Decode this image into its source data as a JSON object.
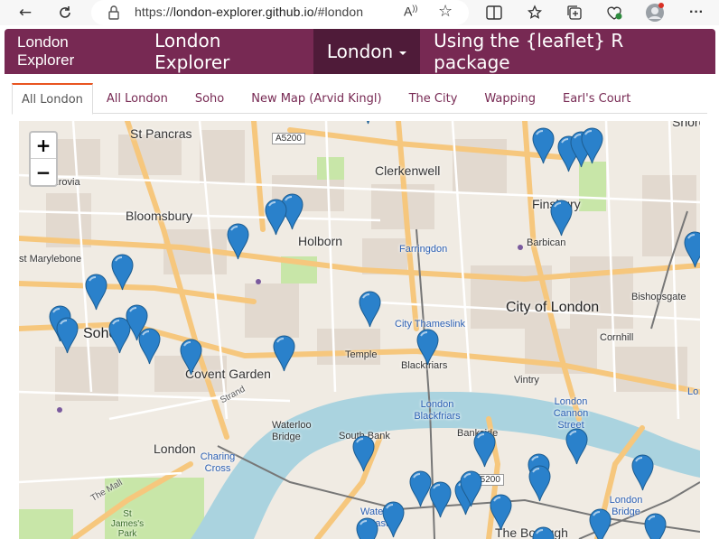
{
  "browser": {
    "url_prefix": "https://",
    "url_host": "london-explorer.github.io",
    "url_path": "/#london",
    "read_aloud_label": "A̅"
  },
  "navbar": {
    "brand": "London Explorer",
    "items": [
      {
        "label": "London Explorer"
      },
      {
        "label": "London"
      },
      {
        "label": "Using the {leaflet} R package"
      }
    ]
  },
  "tabs": [
    {
      "label": "All London",
      "active": true
    },
    {
      "label": "All London"
    },
    {
      "label": "Soho"
    },
    {
      "label": "New Map (Arvid Kingl)"
    },
    {
      "label": "The City"
    },
    {
      "label": "Wapping"
    },
    {
      "label": "Earl's Court"
    }
  ],
  "map": {
    "zoom_in": "+",
    "zoom_out": "−",
    "marker_color": "#2a81cb",
    "labels": {
      "st_pancras": "St Pancras",
      "fitzrovia": "Fitzrovia",
      "bloomsbury": "Bloomsbury",
      "marylebone": "st Marylebone",
      "holborn": "Holborn",
      "clerkenwell": "Clerkenwell",
      "farringdon": "Farringdon",
      "finsbury": "Finsbury",
      "barbican": "Barbican",
      "shoreditch": "Shoredit",
      "bishopsgate": "Bishopsgate",
      "city_of_london": "City of London",
      "cornhill": "Cornhill",
      "soho": "Soho",
      "covent_garden": "Covent Garden",
      "city_thameslink": "City Thameslink",
      "temple": "Temple",
      "blackfriars": "Blackfriars",
      "vintry": "Vintry",
      "strand": "Strand",
      "waterloo_bridge": "Waterloo Bridge",
      "south_bank": "South Bank",
      "london_blackfriars": "London Blackfriars",
      "bankside": "Bankside",
      "london_cannon_street": "London Cannon Street",
      "london_bridge": "London Bridge",
      "london": "London",
      "charing_cross": "Charing Cross",
      "the_mall": "The Mall",
      "st_james_park": "St James's Park",
      "waterloo_east": "Waterloo East",
      "the_borough": "The Borough",
      "london_edge": "Lo",
      "a5200": "A5200",
      "a5200b": "A5200",
      "a200": "200"
    }
  }
}
